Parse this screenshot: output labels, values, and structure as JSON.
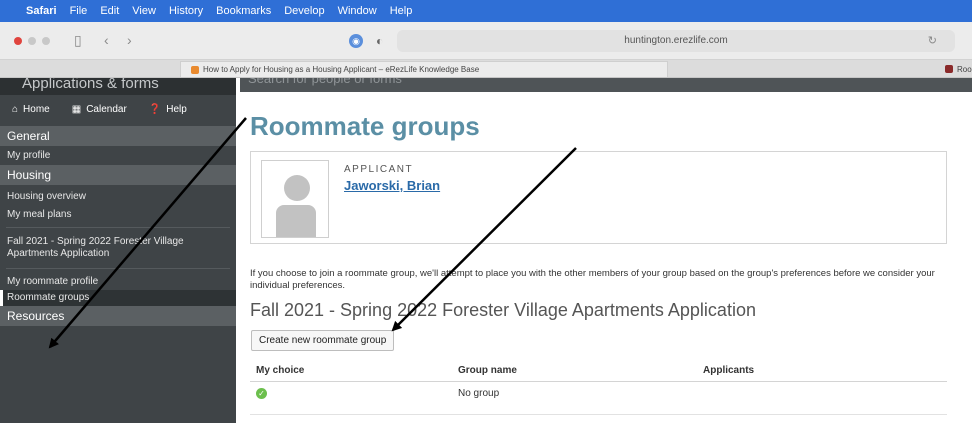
{
  "menubar": {
    "app": "Safari",
    "items": [
      "File",
      "Edit",
      "View",
      "History",
      "Bookmarks",
      "Develop",
      "Window",
      "Help"
    ]
  },
  "browser": {
    "url": "huntington.erezlife.com",
    "active_tab": "How to Apply for Housing as a Housing Applicant – eRezLife Knowledge Base",
    "other_tab": "Roor"
  },
  "sidebar": {
    "header_partial": "Applications & forms",
    "nav": [
      "Home",
      "Calendar",
      "Help"
    ],
    "sections": {
      "general": "General",
      "housing": "Housing",
      "resources": "Resources"
    },
    "general_items": [
      "My profile"
    ],
    "housing_group1": [
      "Housing overview",
      "My meal plans"
    ],
    "housing_application": "Fall 2021 - Spring 2022 Forester Village Apartments Application",
    "housing_group3": [
      "My roommate profile",
      "Roommate groups"
    ]
  },
  "main": {
    "faded_search": "Search for people or forms",
    "title": "Roommate groups",
    "applicant_label": "APPLICANT",
    "applicant_name": "Jaworski, Brian",
    "intro": "If you choose to join a roommate group, we'll attempt to place you with the other members of your group based on the group's preferences before we consider your individual preferences.",
    "application_title": "Fall 2021 - Spring 2022 Forester Village Apartments Application",
    "create_button": "Create new roommate group",
    "table": {
      "headers": [
        "My choice",
        "Group name",
        "Applicants"
      ],
      "rows": [
        {
          "choice_icon": "check-icon",
          "group_name": "No group",
          "applicants": ""
        }
      ]
    }
  },
  "colors": {
    "menubar": "#2f6fd6",
    "sidebar": "#3f4447",
    "title": "#5b8fa5",
    "link": "#2a6aa8",
    "check": "#6cbf4d"
  }
}
